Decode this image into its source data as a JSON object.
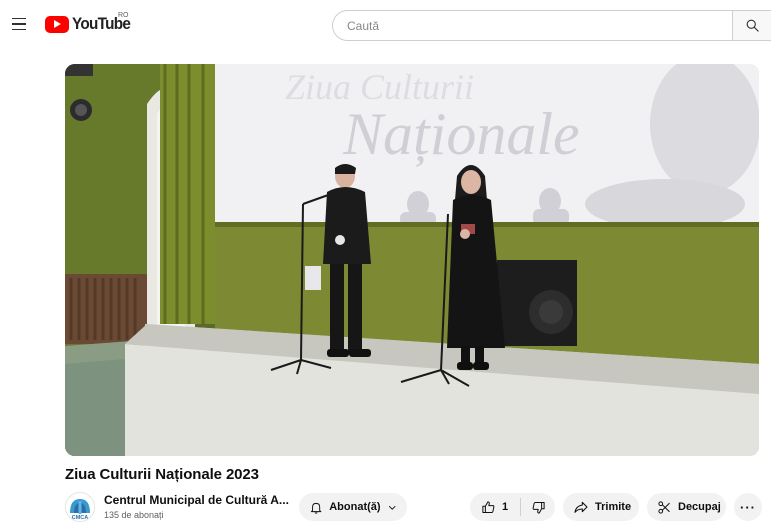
{
  "header": {
    "logo_text": "YouTube",
    "region": "RO",
    "search_placeholder": "Caută"
  },
  "video": {
    "screen_text_top": "Ziua Culturii",
    "screen_text_main": "Naționale"
  },
  "title": "Ziua Culturii Naționale 2023",
  "channel": {
    "name": "Centrul Municipal de Cultură A...",
    "subscribers": "135 de abonați",
    "avatar_text": "CMCA"
  },
  "actions": {
    "subscribe_label": "Abonat(ă)",
    "like_count": "1",
    "share_label": "Trimite",
    "clip_label": "Decupaj",
    "more_label": "···"
  },
  "icons": [
    "menu-icon",
    "youtube-logo-icon",
    "search-icon",
    "bell-icon",
    "chevron-down-icon",
    "thumbs-up-icon",
    "thumbs-down-icon",
    "share-arrow-icon",
    "scissors-icon",
    "more-icon"
  ],
  "colors": {
    "brand": "#ff0000",
    "pill": "#f2f2f2",
    "wall": "#7d8a33",
    "screen": "#f1f1f3"
  }
}
